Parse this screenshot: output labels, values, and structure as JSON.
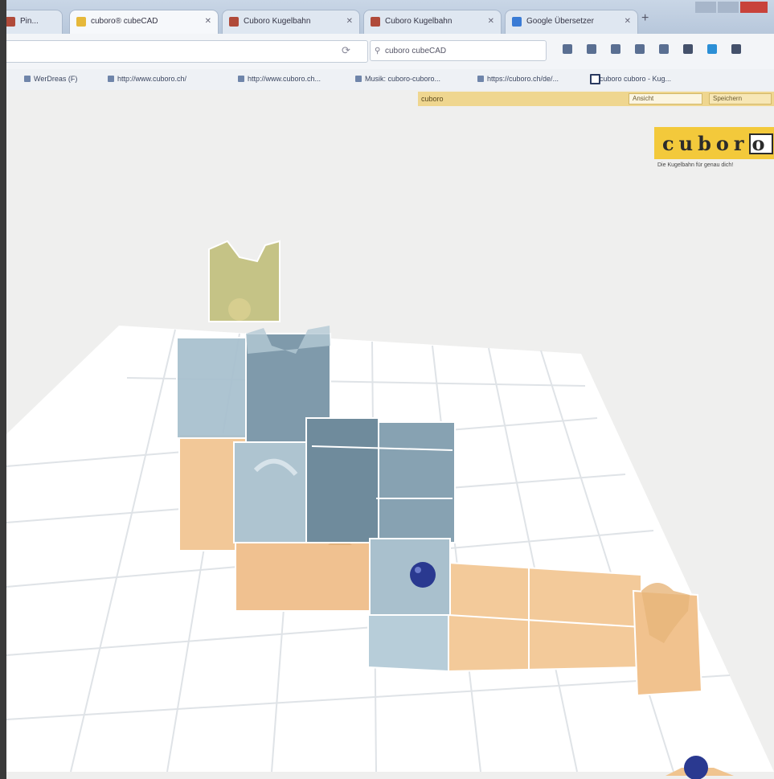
{
  "browser": {
    "tabs": [
      {
        "label": "Pin...",
        "active": false
      },
      {
        "label": "cuboro® cubeCAD",
        "active": true
      },
      {
        "label": "Cuboro Kugelbahn",
        "active": false
      },
      {
        "label": "Cuboro Kugelbahn",
        "active": false
      },
      {
        "label": "Google Übersetzer",
        "active": false
      }
    ],
    "new_tab_label": "+",
    "search_value": "cuboro cubeCAD",
    "bookmarks": [
      {
        "label": "WerDreas (F)"
      },
      {
        "label": "http://www.cuboro.ch/"
      },
      {
        "label": "http://www.cuboro.ch..."
      },
      {
        "label": "Musik: cuboro-cuboro..."
      },
      {
        "label": "https://cuboro.ch/de/..."
      },
      {
        "label": "cuboro cuboro - Kug..."
      }
    ]
  },
  "app": {
    "name_field_value": "cuboro",
    "toolbar_input_value": "Ansicht",
    "toolbar_button_label": "Speichern",
    "logo_text": "cubor",
    "logo_box_text": "o",
    "tagline": "Die Kugelbahn für genau dich!"
  },
  "colors": {
    "tan_cube": "#f0c896",
    "blue_cube": "#9fb8c7",
    "dark_blue_cube": "#6a8596",
    "olive_cube": "#c6c48a",
    "marble": "#2b3a8c",
    "logo_yellow": "#f3c93b"
  }
}
